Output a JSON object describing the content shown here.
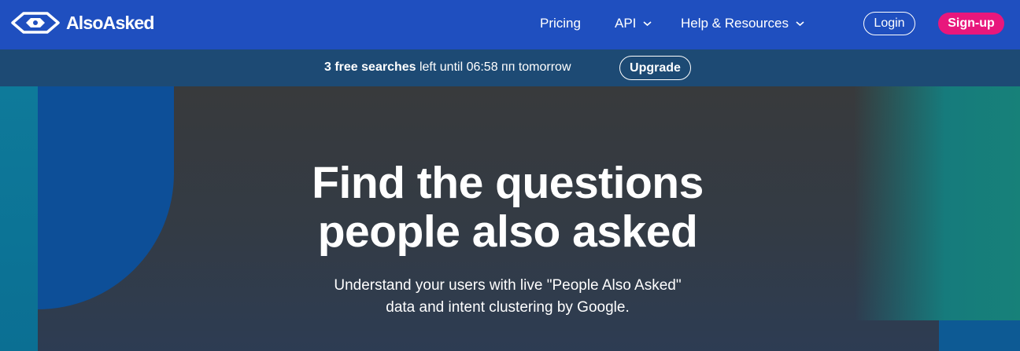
{
  "header": {
    "brand": "AlsoAsked",
    "nav": [
      {
        "label": "Pricing",
        "has_dropdown": false
      },
      {
        "label": "API",
        "has_dropdown": true
      },
      {
        "label": "Help & Resources",
        "has_dropdown": true
      }
    ],
    "login_label": "Login",
    "signup_label": "Sign-up"
  },
  "banner": {
    "count_text": "3 free searches",
    "rest_text": " left until 06:58 пп tomorrow",
    "upgrade_label": "Upgrade"
  },
  "hero": {
    "title_line1": "Find the questions",
    "title_line2": "people also asked",
    "subtitle_line1": "Understand your users with live \"People Also Asked\"",
    "subtitle_line2": "data and intent clustering by Google."
  },
  "colors": {
    "nav_bg": "#1f4fbf",
    "banner_bg": "#1d4a74",
    "signup_accent": "#e8177c",
    "hero_bg": "#353a42"
  },
  "icons": [
    "alsoasked-logo-icon",
    "chevron-down-icon"
  ]
}
